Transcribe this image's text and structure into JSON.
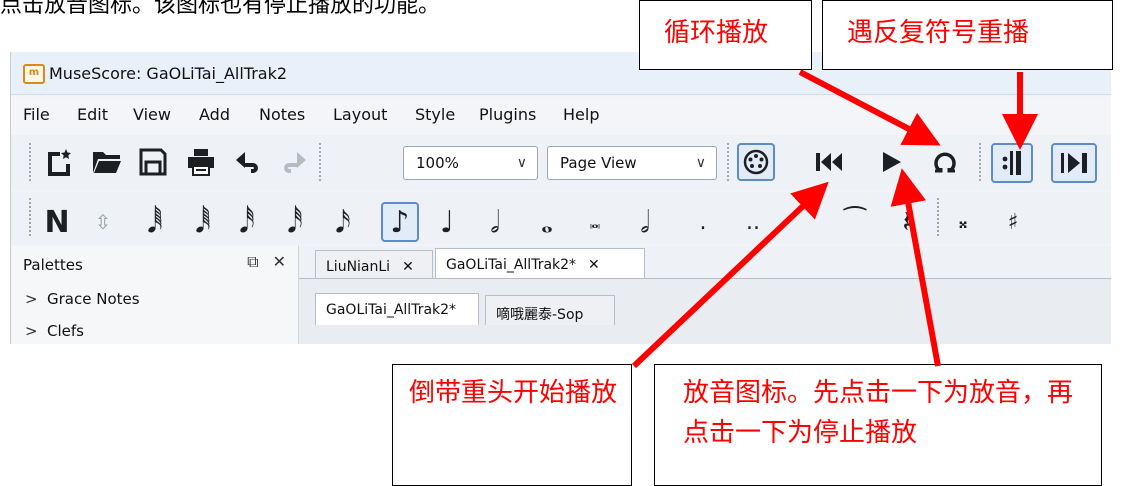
{
  "intro_text": "点击放音图标。该图标也有停止播放的功能。",
  "window": {
    "title": "MuseScore: GaOLiTai_AllTrak2"
  },
  "menu": [
    "File",
    "Edit",
    "View",
    "Add",
    "Notes",
    "Layout",
    "Style",
    "Plugins",
    "Help"
  ],
  "toolbar": {
    "zoom_value": "100%",
    "view_mode": "Page View"
  },
  "palettes": {
    "title": "Palettes",
    "items": [
      "Grace Notes",
      "Clefs"
    ]
  },
  "tabs": {
    "top": [
      {
        "label": "LiuNianLi",
        "close": "✕"
      },
      {
        "label": "GaOLiTai_AllTrak2*",
        "close": "✕"
      }
    ],
    "sub": [
      "GaOLiTai_AllTrak2*",
      "嘀哦麗泰-Sop"
    ]
  },
  "callouts": {
    "loop": "循环播放",
    "repeat": "遇反复符号重播",
    "rewind": "倒带重头开始播放",
    "play": "放音图标。先点击一下为放音，再点击一下为停止播放"
  },
  "icons": [
    "new-score-icon",
    "open-icon",
    "save-icon",
    "print-icon",
    "undo-icon",
    "redo-icon",
    "midi-input-icon",
    "rewind-icon",
    "play-icon",
    "loop-icon",
    "play-repeats-icon",
    "pan-score-icon"
  ],
  "colors": {
    "annotation": "#ff0000",
    "toggle_border": "#5e8cc7"
  }
}
